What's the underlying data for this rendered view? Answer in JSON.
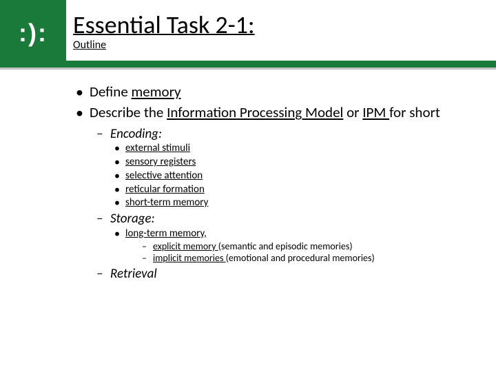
{
  "logo": ": ) ) :",
  "title": "Essential Task 2-1:",
  "subtitle": "Outline",
  "bullets": {
    "b1a_pre": "Define ",
    "b1a_u": "memory",
    "b1b_pre": "Describe the ",
    "b1b_u1": "Information Processing Model",
    "b1b_mid": " or ",
    "b1b_u2": "IPM ",
    "b1b_post": "for short",
    "encoding_label": "Encoding:",
    "enc_items": {
      "i1": "external stimuli",
      "i2": "sensory registers",
      "i3": "selective attention",
      "i4": "reticular formation",
      "i5": "short-term memory"
    },
    "storage_label": "Storage:",
    "storage_ltm": "long-term memory,",
    "storage_sub1_u": "explicit memory ",
    "storage_sub1_tail": "(semantic and episodic memories)",
    "storage_sub2_u": "implicit memories ",
    "storage_sub2_tail": "(emotional and procedural memories)",
    "retrieval_label": "Retrieval"
  }
}
